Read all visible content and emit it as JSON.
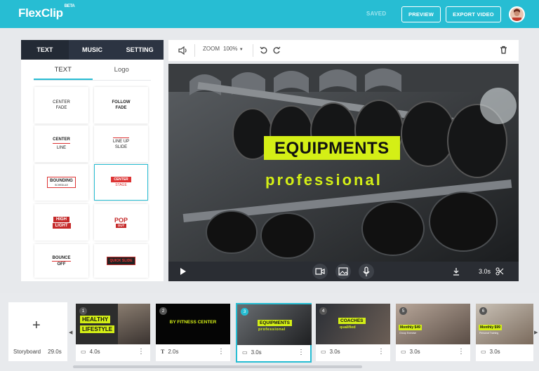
{
  "app": {
    "logo": "FlexClip",
    "beta": "BETA",
    "saved": "SAVED",
    "preview": "PREVIEW",
    "export": "EXPORT VIDEO"
  },
  "tabs": [
    "TEXT",
    "MUSIC",
    "SETTING"
  ],
  "subtabs": [
    "TEXT",
    "Logo"
  ],
  "tiles": [
    {
      "l1": "CENTER",
      "l2": "FADE"
    },
    {
      "l1": "FOLLOW",
      "l2": "FADE"
    },
    {
      "l1": "CENTER",
      "l2": "LINE"
    },
    {
      "l1": "LINE UP",
      "l2": "SLIDE"
    },
    {
      "l1": "BOUNDING",
      "l2": "SCHEDULE"
    },
    {
      "l1": "CENTER",
      "l2": "STAGE"
    },
    {
      "l1": "HIGH",
      "l2": "LIGHT"
    },
    {
      "l1": "POP",
      "l2": "OUT"
    },
    {
      "l1": "BOUNCE",
      "l2": "OFF"
    },
    {
      "l1": "QUICK SLIDE",
      "l2": ""
    }
  ],
  "toolbar": {
    "zoom_label": "ZOOM",
    "zoom_value": "100%"
  },
  "canvas": {
    "headline": "EQUIPMENTS",
    "sub": "professional"
  },
  "controls": {
    "duration": "3.0s"
  },
  "storyboard": {
    "label": "Storyboard",
    "total": "29.0s",
    "clips": [
      {
        "num": "1",
        "title1": "HEALTHY",
        "title2": "LIFESTYLE",
        "dur": "4.0s"
      },
      {
        "num": "2",
        "title1": "BY FITNESS CENTER",
        "title2": "",
        "dur": "2.0s"
      },
      {
        "num": "3",
        "title1": "EQUIPMENTS",
        "title2": "professional",
        "dur": "3.0s"
      },
      {
        "num": "4",
        "title1": "COACHES",
        "title2": "qualified",
        "dur": "3.0s"
      },
      {
        "num": "5",
        "title1": "Monthly $49",
        "title2": "Group Exercise",
        "dur": "3.0s"
      },
      {
        "num": "6",
        "title1": "Monthly $99",
        "title2": "Personal Training",
        "dur": "3.0s"
      }
    ]
  },
  "colors": {
    "accent": "#27bdd3",
    "highlight": "#d4ef16",
    "dark": "#2c3442"
  }
}
